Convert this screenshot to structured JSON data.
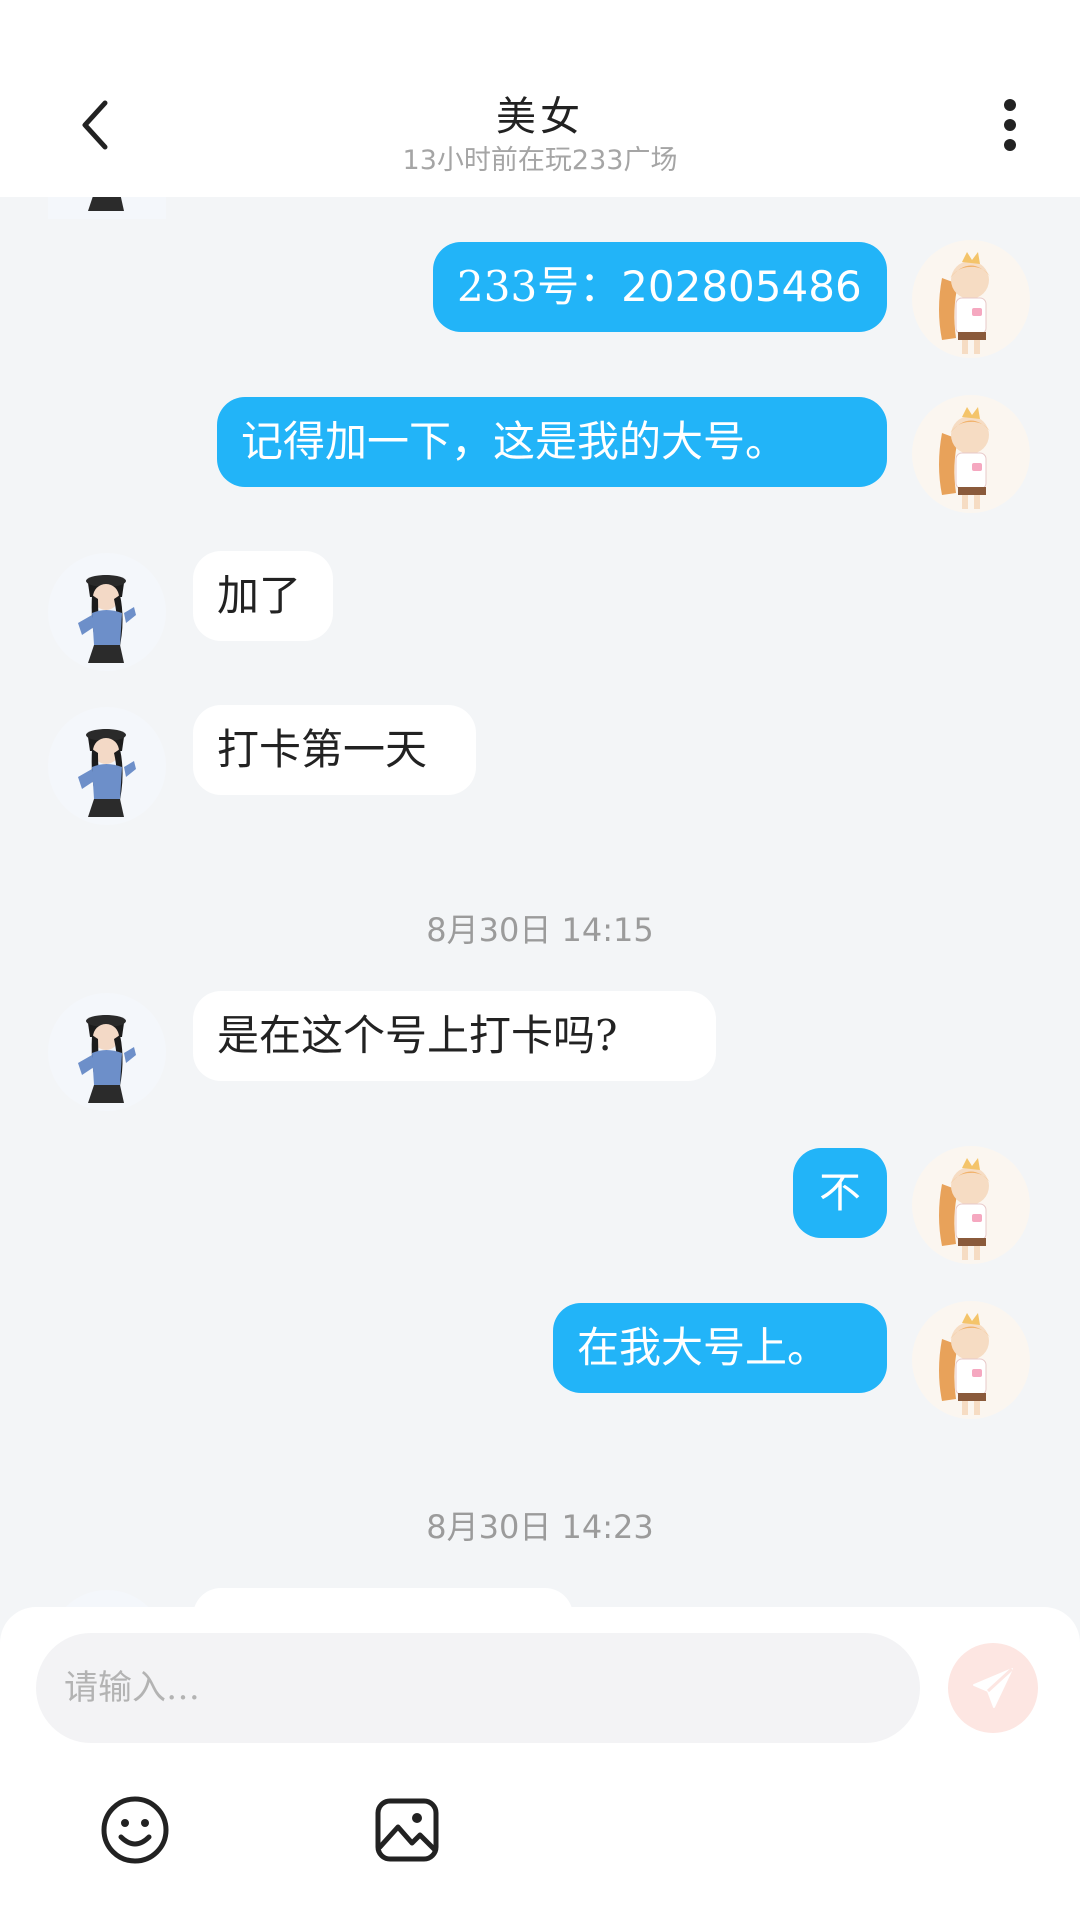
{
  "header": {
    "title": "美女",
    "subtitle": "13小时前在玩233广场"
  },
  "messages": [
    {
      "side": "me",
      "text_prefix": "233号：",
      "text_number": "202805486"
    },
    {
      "side": "me",
      "text": "记得加一下，这是我的大号。"
    },
    {
      "side": "them",
      "text": "加了"
    },
    {
      "side": "them",
      "text": "打卡第一天"
    },
    {
      "timestamp": "8月30日 14:15"
    },
    {
      "side": "them",
      "text": "是在这个号上打卡吗?"
    },
    {
      "side": "me",
      "text": "不"
    },
    {
      "side": "me",
      "text": "在我大号上。"
    },
    {
      "timestamp": "8月30日 14:23"
    }
  ],
  "composer": {
    "placeholder": "请输入…"
  },
  "icons": {
    "back": "chevron-left-icon",
    "more": "vertical-dots-icon",
    "send": "paper-plane-icon",
    "emoji": "smiley-icon",
    "image": "image-icon"
  },
  "colors": {
    "my_bubble": "#22b4f8",
    "their_bubble": "#ffffff",
    "background": "#f3f5f7",
    "send_button": "#fde6e2"
  }
}
